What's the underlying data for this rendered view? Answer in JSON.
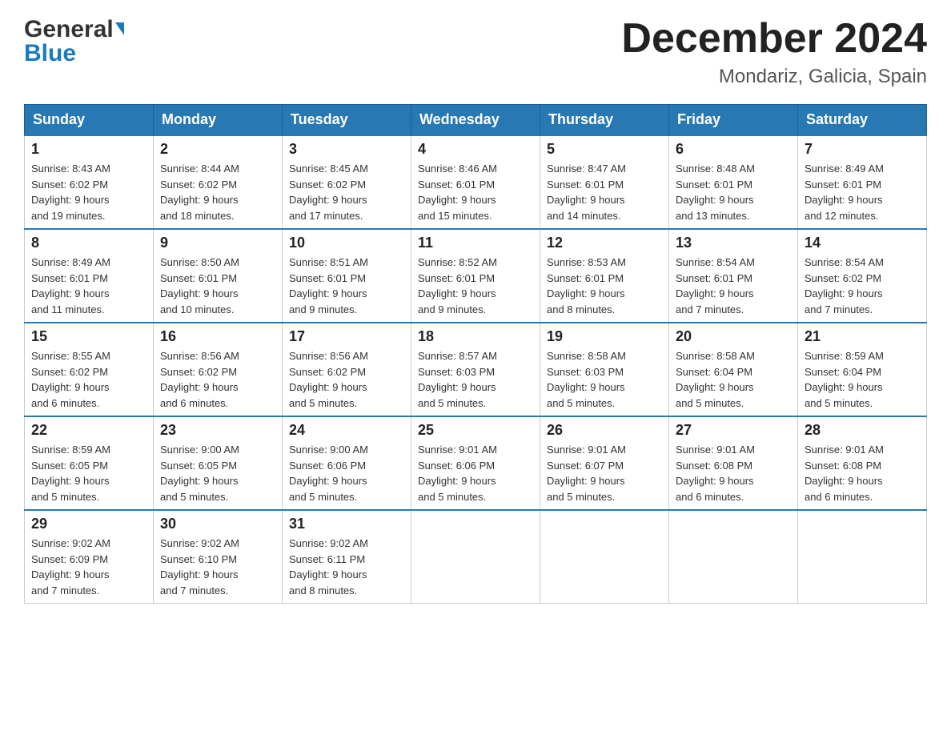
{
  "header": {
    "logo_general": "General",
    "logo_blue": "Blue",
    "month_title": "December 2024",
    "location": "Mondariz, Galicia, Spain"
  },
  "days_of_week": [
    "Sunday",
    "Monday",
    "Tuesday",
    "Wednesday",
    "Thursday",
    "Friday",
    "Saturday"
  ],
  "weeks": [
    [
      {
        "day": "1",
        "sunrise": "8:43 AM",
        "sunset": "6:02 PM",
        "daylight": "9 hours and 19 minutes."
      },
      {
        "day": "2",
        "sunrise": "8:44 AM",
        "sunset": "6:02 PM",
        "daylight": "9 hours and 18 minutes."
      },
      {
        "day": "3",
        "sunrise": "8:45 AM",
        "sunset": "6:02 PM",
        "daylight": "9 hours and 17 minutes."
      },
      {
        "day": "4",
        "sunrise": "8:46 AM",
        "sunset": "6:01 PM",
        "daylight": "9 hours and 15 minutes."
      },
      {
        "day": "5",
        "sunrise": "8:47 AM",
        "sunset": "6:01 PM",
        "daylight": "9 hours and 14 minutes."
      },
      {
        "day": "6",
        "sunrise": "8:48 AM",
        "sunset": "6:01 PM",
        "daylight": "9 hours and 13 minutes."
      },
      {
        "day": "7",
        "sunrise": "8:49 AM",
        "sunset": "6:01 PM",
        "daylight": "9 hours and 12 minutes."
      }
    ],
    [
      {
        "day": "8",
        "sunrise": "8:49 AM",
        "sunset": "6:01 PM",
        "daylight": "9 hours and 11 minutes."
      },
      {
        "day": "9",
        "sunrise": "8:50 AM",
        "sunset": "6:01 PM",
        "daylight": "9 hours and 10 minutes."
      },
      {
        "day": "10",
        "sunrise": "8:51 AM",
        "sunset": "6:01 PM",
        "daylight": "9 hours and 9 minutes."
      },
      {
        "day": "11",
        "sunrise": "8:52 AM",
        "sunset": "6:01 PM",
        "daylight": "9 hours and 9 minutes."
      },
      {
        "day": "12",
        "sunrise": "8:53 AM",
        "sunset": "6:01 PM",
        "daylight": "9 hours and 8 minutes."
      },
      {
        "day": "13",
        "sunrise": "8:54 AM",
        "sunset": "6:01 PM",
        "daylight": "9 hours and 7 minutes."
      },
      {
        "day": "14",
        "sunrise": "8:54 AM",
        "sunset": "6:02 PM",
        "daylight": "9 hours and 7 minutes."
      }
    ],
    [
      {
        "day": "15",
        "sunrise": "8:55 AM",
        "sunset": "6:02 PM",
        "daylight": "9 hours and 6 minutes."
      },
      {
        "day": "16",
        "sunrise": "8:56 AM",
        "sunset": "6:02 PM",
        "daylight": "9 hours and 6 minutes."
      },
      {
        "day": "17",
        "sunrise": "8:56 AM",
        "sunset": "6:02 PM",
        "daylight": "9 hours and 5 minutes."
      },
      {
        "day": "18",
        "sunrise": "8:57 AM",
        "sunset": "6:03 PM",
        "daylight": "9 hours and 5 minutes."
      },
      {
        "day": "19",
        "sunrise": "8:58 AM",
        "sunset": "6:03 PM",
        "daylight": "9 hours and 5 minutes."
      },
      {
        "day": "20",
        "sunrise": "8:58 AM",
        "sunset": "6:04 PM",
        "daylight": "9 hours and 5 minutes."
      },
      {
        "day": "21",
        "sunrise": "8:59 AM",
        "sunset": "6:04 PM",
        "daylight": "9 hours and 5 minutes."
      }
    ],
    [
      {
        "day": "22",
        "sunrise": "8:59 AM",
        "sunset": "6:05 PM",
        "daylight": "9 hours and 5 minutes."
      },
      {
        "day": "23",
        "sunrise": "9:00 AM",
        "sunset": "6:05 PM",
        "daylight": "9 hours and 5 minutes."
      },
      {
        "day": "24",
        "sunrise": "9:00 AM",
        "sunset": "6:06 PM",
        "daylight": "9 hours and 5 minutes."
      },
      {
        "day": "25",
        "sunrise": "9:01 AM",
        "sunset": "6:06 PM",
        "daylight": "9 hours and 5 minutes."
      },
      {
        "day": "26",
        "sunrise": "9:01 AM",
        "sunset": "6:07 PM",
        "daylight": "9 hours and 5 minutes."
      },
      {
        "day": "27",
        "sunrise": "9:01 AM",
        "sunset": "6:08 PM",
        "daylight": "9 hours and 6 minutes."
      },
      {
        "day": "28",
        "sunrise": "9:01 AM",
        "sunset": "6:08 PM",
        "daylight": "9 hours and 6 minutes."
      }
    ],
    [
      {
        "day": "29",
        "sunrise": "9:02 AM",
        "sunset": "6:09 PM",
        "daylight": "9 hours and 7 minutes."
      },
      {
        "day": "30",
        "sunrise": "9:02 AM",
        "sunset": "6:10 PM",
        "daylight": "9 hours and 7 minutes."
      },
      {
        "day": "31",
        "sunrise": "9:02 AM",
        "sunset": "6:11 PM",
        "daylight": "9 hours and 8 minutes."
      },
      null,
      null,
      null,
      null
    ]
  ],
  "labels": {
    "sunrise": "Sunrise:",
    "sunset": "Sunset:",
    "daylight": "Daylight:"
  }
}
